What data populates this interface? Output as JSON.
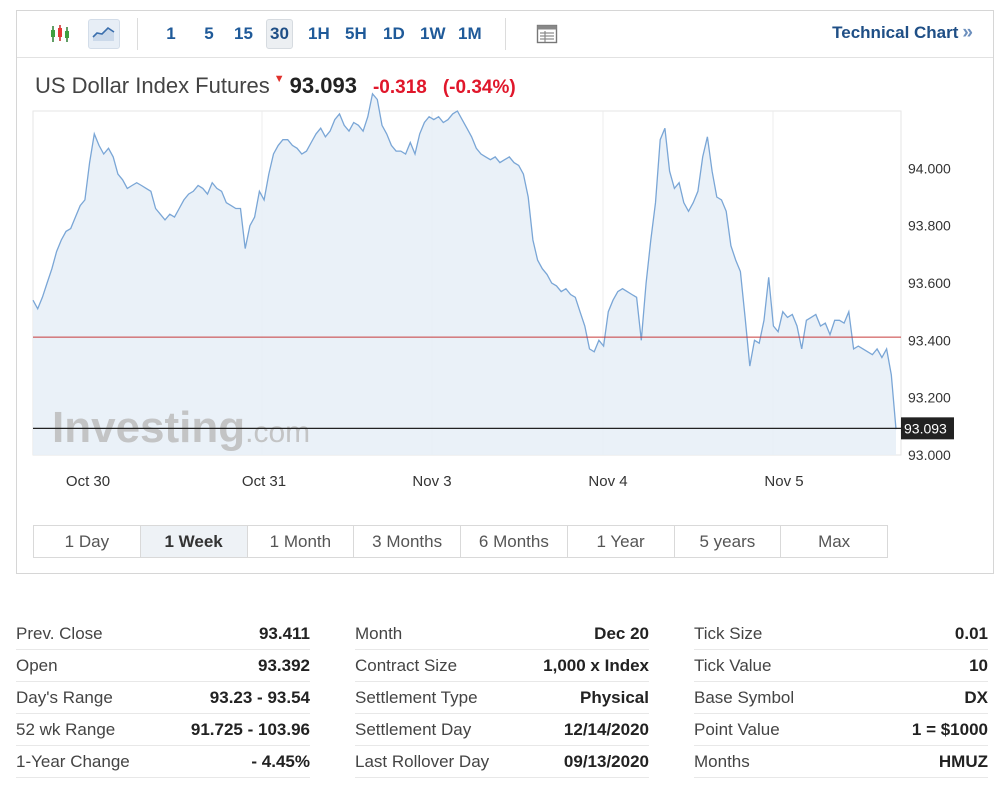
{
  "toolbar": {
    "chart_types": [
      {
        "icon": "candlestick-icon",
        "active": false
      },
      {
        "icon": "line-chart-icon",
        "active": true
      }
    ],
    "intervals": [
      {
        "label": "1",
        "active": false
      },
      {
        "label": "5",
        "active": false
      },
      {
        "label": "15",
        "active": false
      },
      {
        "label": "30",
        "active": true
      },
      {
        "label": "1H",
        "active": false
      },
      {
        "label": "5H",
        "active": false
      },
      {
        "label": "1D",
        "active": false
      },
      {
        "label": "1W",
        "active": false
      },
      {
        "label": "1M",
        "active": false
      }
    ],
    "table_view_icon": "table-view-icon",
    "tech_chart_label": "Technical Chart",
    "tech_chart_arrow": "»"
  },
  "header": {
    "instrument": "US Dollar Index Futures",
    "last": "93.093",
    "change": "-0.318",
    "change_pct": "(-0.34%)",
    "trend_icon": "down-triangle-icon"
  },
  "chart_data": {
    "type": "area",
    "watermark_brand": "Investing",
    "watermark_suffix": ".com",
    "ylim": [
      93.0,
      94.2
    ],
    "y_ticks": [
      "94.000",
      "93.800",
      "93.600",
      "93.400",
      "93.200",
      "93.000"
    ],
    "x_labels": [
      "Oct 30",
      "Oct 31",
      "Nov 3",
      "Nov 4",
      "Nov 5"
    ],
    "prev_close": 93.411,
    "last_value": 93.093,
    "last_label": "93.093",
    "colors": {
      "line": "#7aa6d6",
      "fill": "#e8f0f7",
      "prev_close": "#c63b3b",
      "last": "#222222"
    },
    "series": [
      {
        "values": [
          93.54,
          93.51,
          93.55,
          93.6,
          93.65,
          93.71,
          93.75,
          93.78,
          93.79,
          93.83,
          93.87,
          93.89,
          94.02,
          94.12,
          94.08,
          94.05,
          94.07,
          94.04,
          93.98,
          93.96,
          93.93,
          93.94,
          93.95,
          93.94,
          93.93,
          93.92,
          93.86,
          93.84,
          93.82,
          93.84,
          93.83,
          93.86,
          93.89,
          93.91,
          93.92,
          93.94,
          93.93,
          93.91,
          93.95,
          93.93,
          93.92,
          93.88,
          93.87,
          93.86,
          93.86,
          93.72,
          93.8,
          93.83,
          93.92,
          93.89,
          93.98,
          94.05,
          94.08,
          94.1,
          94.1,
          94.08,
          94.07,
          94.05,
          94.06,
          94.09,
          94.12,
          94.14,
          94.11,
          94.13,
          94.17,
          94.19,
          94.15,
          94.13,
          94.16,
          94.15,
          94.13,
          94.18,
          94.26,
          94.24,
          94.15,
          94.12,
          94.08,
          94.06,
          94.06,
          94.05,
          94.09,
          94.05,
          94.12,
          94.16,
          94.18,
          94.17,
          94.18,
          94.16,
          94.17,
          94.19,
          94.2,
          94.17,
          94.14,
          94.11,
          94.07,
          94.05,
          94.04,
          94.03,
          94.04,
          94.02,
          94.03,
          94.04,
          94.02,
          94.01,
          93.98,
          93.9,
          93.75,
          93.68,
          93.65,
          93.63,
          93.6,
          93.59,
          93.57,
          93.58,
          93.56,
          93.55,
          93.5,
          93.45,
          93.37,
          93.36,
          93.4,
          93.38,
          93.5,
          93.54,
          93.57,
          93.58,
          93.57,
          93.56,
          93.55,
          93.4,
          93.6,
          93.75,
          93.88,
          94.1,
          94.14,
          93.99,
          93.93,
          93.95,
          93.88,
          93.85,
          93.88,
          93.92,
          94.04,
          94.11,
          93.99,
          93.9,
          93.89,
          93.85,
          93.73,
          93.68,
          93.64,
          93.48,
          93.31,
          93.4,
          93.39,
          93.47,
          93.62,
          93.45,
          93.43,
          93.5,
          93.48,
          93.49,
          93.45,
          93.37,
          93.47,
          93.48,
          93.49,
          93.45,
          93.46,
          93.42,
          93.47,
          93.47,
          93.46,
          93.5,
          93.37,
          93.38,
          93.37,
          93.36,
          93.35,
          93.37,
          93.34,
          93.37,
          93.28,
          93.09
        ]
      }
    ]
  },
  "ranges": [
    {
      "label": "1 Day",
      "active": false
    },
    {
      "label": "1 Week",
      "active": true
    },
    {
      "label": "1 Month",
      "active": false
    },
    {
      "label": "3 Months",
      "active": false
    },
    {
      "label": "6 Months",
      "active": false
    },
    {
      "label": "1 Year",
      "active": false
    },
    {
      "label": "5 years",
      "active": false
    },
    {
      "label": "Max",
      "active": false
    }
  ],
  "stats": [
    [
      {
        "label": "Prev. Close",
        "value": "93.411"
      },
      {
        "label": "Open",
        "value": "93.392"
      },
      {
        "label": "Day's Range",
        "value": "93.23 - 93.54"
      },
      {
        "label": "52 wk Range",
        "value": "91.725 - 103.96"
      },
      {
        "label": "1-Year Change",
        "value": "- 4.45%"
      }
    ],
    [
      {
        "label": "Month",
        "value": "Dec 20"
      },
      {
        "label": "Contract Size",
        "value": "1,000 x Index"
      },
      {
        "label": "Settlement Type",
        "value": "Physical"
      },
      {
        "label": "Settlement Day",
        "value": "12/14/2020"
      },
      {
        "label": "Last Rollover Day",
        "value": "09/13/2020"
      }
    ],
    [
      {
        "label": "Tick Size",
        "value": "0.01"
      },
      {
        "label": "Tick Value",
        "value": "10"
      },
      {
        "label": "Base Symbol",
        "value": "DX"
      },
      {
        "label": "Point Value",
        "value": "1 = $1000"
      },
      {
        "label": "Months",
        "value": "HMUZ"
      }
    ]
  ]
}
